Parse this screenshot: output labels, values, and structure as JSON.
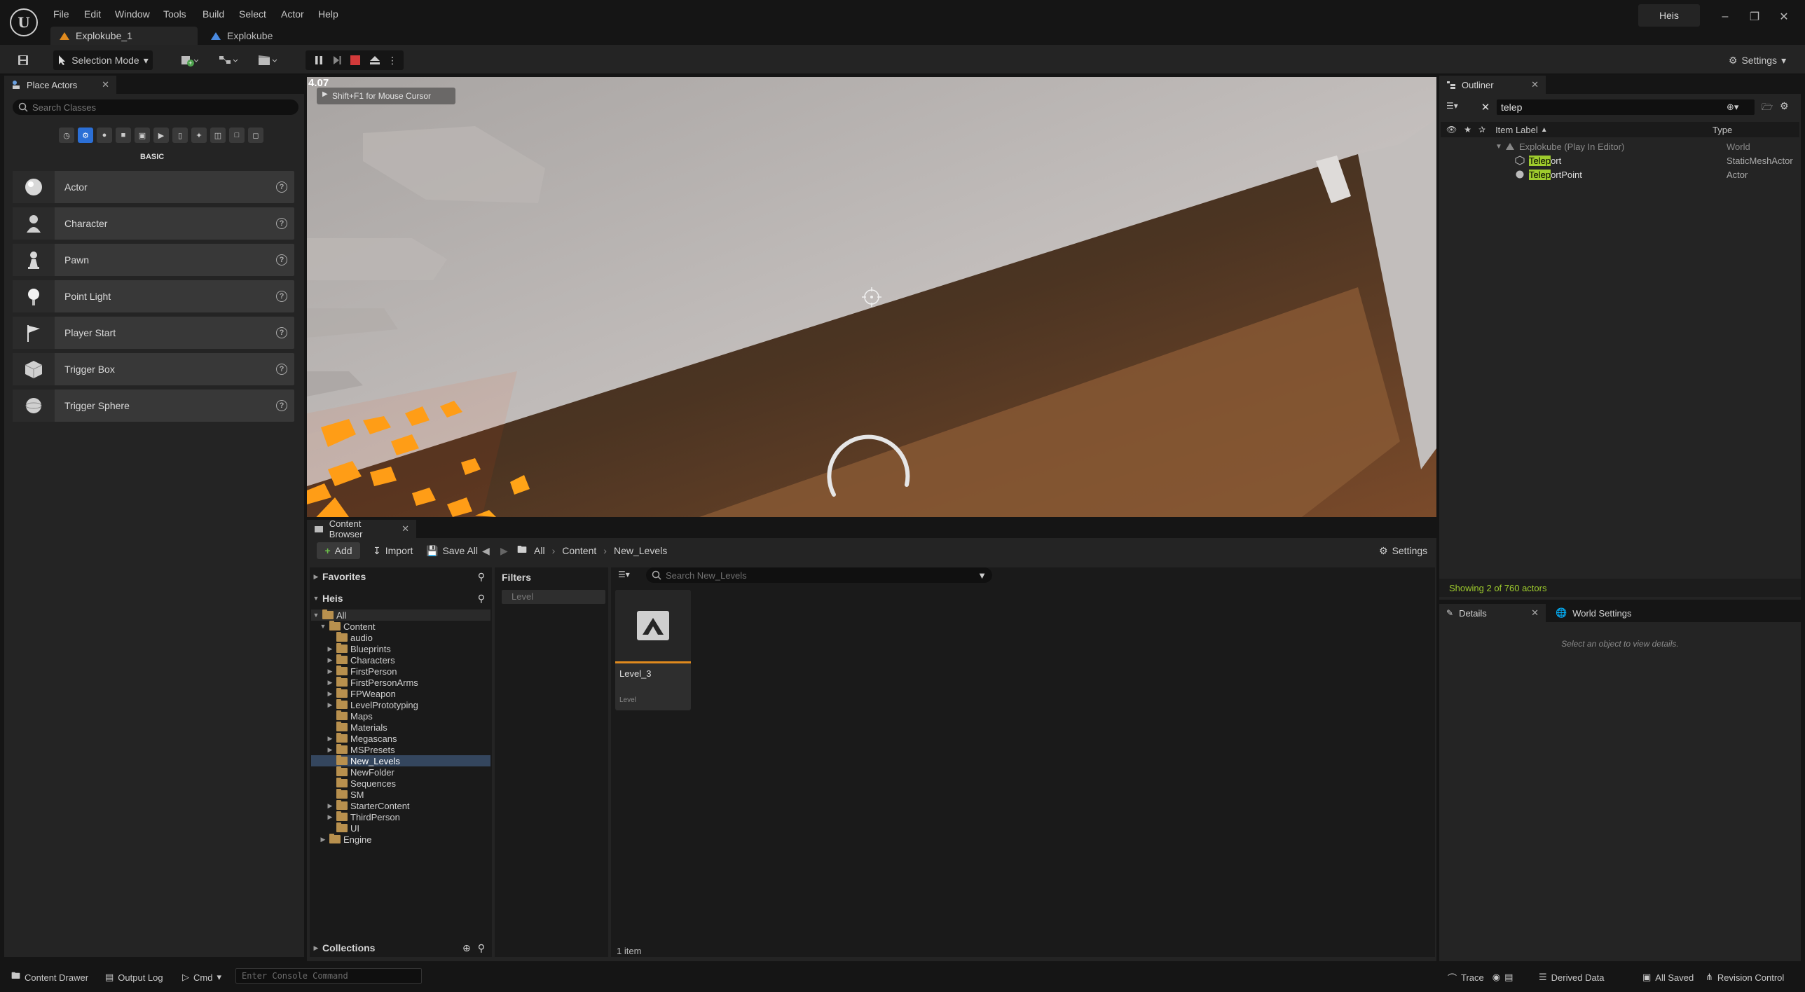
{
  "menu": [
    "File",
    "Edit",
    "Window",
    "Tools",
    "Build",
    "Select",
    "Actor",
    "Help"
  ],
  "tabs": {
    "level_tab": "Explokube_1",
    "project_tab": "Explokube"
  },
  "user": "Heis",
  "toolbar": {
    "selection_mode": "Selection Mode",
    "settings": "Settings"
  },
  "place_actors": {
    "title": "Place Actors",
    "search_placeholder": "Search Classes",
    "category": "BASIC",
    "items": [
      "Actor",
      "Character",
      "Pawn",
      "Point Light",
      "Player Start",
      "Trigger Box",
      "Trigger Sphere"
    ]
  },
  "viewport": {
    "fps": "4.07",
    "hint": "Shift+F1 for Mouse Cursor"
  },
  "outliner": {
    "title": "Outliner",
    "search_value": "telep",
    "col_label": "Item Label",
    "col_type": "Type",
    "world_label": "Explokube (Play In Editor)",
    "world_type": "World",
    "rows": [
      {
        "hl": "Telep",
        "rest": "ort",
        "type": "StaticMeshActor"
      },
      {
        "hl": "Telep",
        "rest": "ortPoint",
        "type": "Actor"
      }
    ],
    "footer": "Showing 2 of 760 actors"
  },
  "details": {
    "tab_details": "Details",
    "tab_world": "World Settings",
    "empty": "Select an object to view details."
  },
  "content_browser": {
    "title": "Content Browser",
    "add": "Add",
    "import": "Import",
    "save_all": "Save All",
    "path": [
      "All",
      "Content",
      "New_Levels"
    ],
    "settings": "Settings",
    "favorites": "Favorites",
    "root_name": "Heis",
    "tree_all": "All",
    "tree_content": "Content",
    "folders": [
      "audio",
      "Blueprints",
      "Characters",
      "FirstPerson",
      "FirstPersonArms",
      "FPWeapon",
      "LevelPrototyping",
      "Maps",
      "Materials",
      "Megascans",
      "MSPresets",
      "New_Levels",
      "NewFolder",
      "Sequences",
      "SM",
      "StarterContent",
      "ThirdPerson",
      "UI"
    ],
    "engine": "Engine",
    "collections": "Collections",
    "filters": "Filters",
    "filter_chip": "Level",
    "search_placeholder": "Search New_Levels",
    "asset_name": "Level_3",
    "asset_type": "Level",
    "item_count": "1 item"
  },
  "statusbar": {
    "content_drawer": "Content Drawer",
    "output_log": "Output Log",
    "cmd": "Cmd",
    "console_placeholder": "Enter Console Command",
    "trace": "Trace",
    "derived_data": "Derived Data",
    "all_saved": "All Saved",
    "revision_control": "Revision Control"
  },
  "colors": {
    "search_highlight": "#9ecb2d",
    "asset_underline": "#e08a1e",
    "stop": "#d33a3a"
  }
}
